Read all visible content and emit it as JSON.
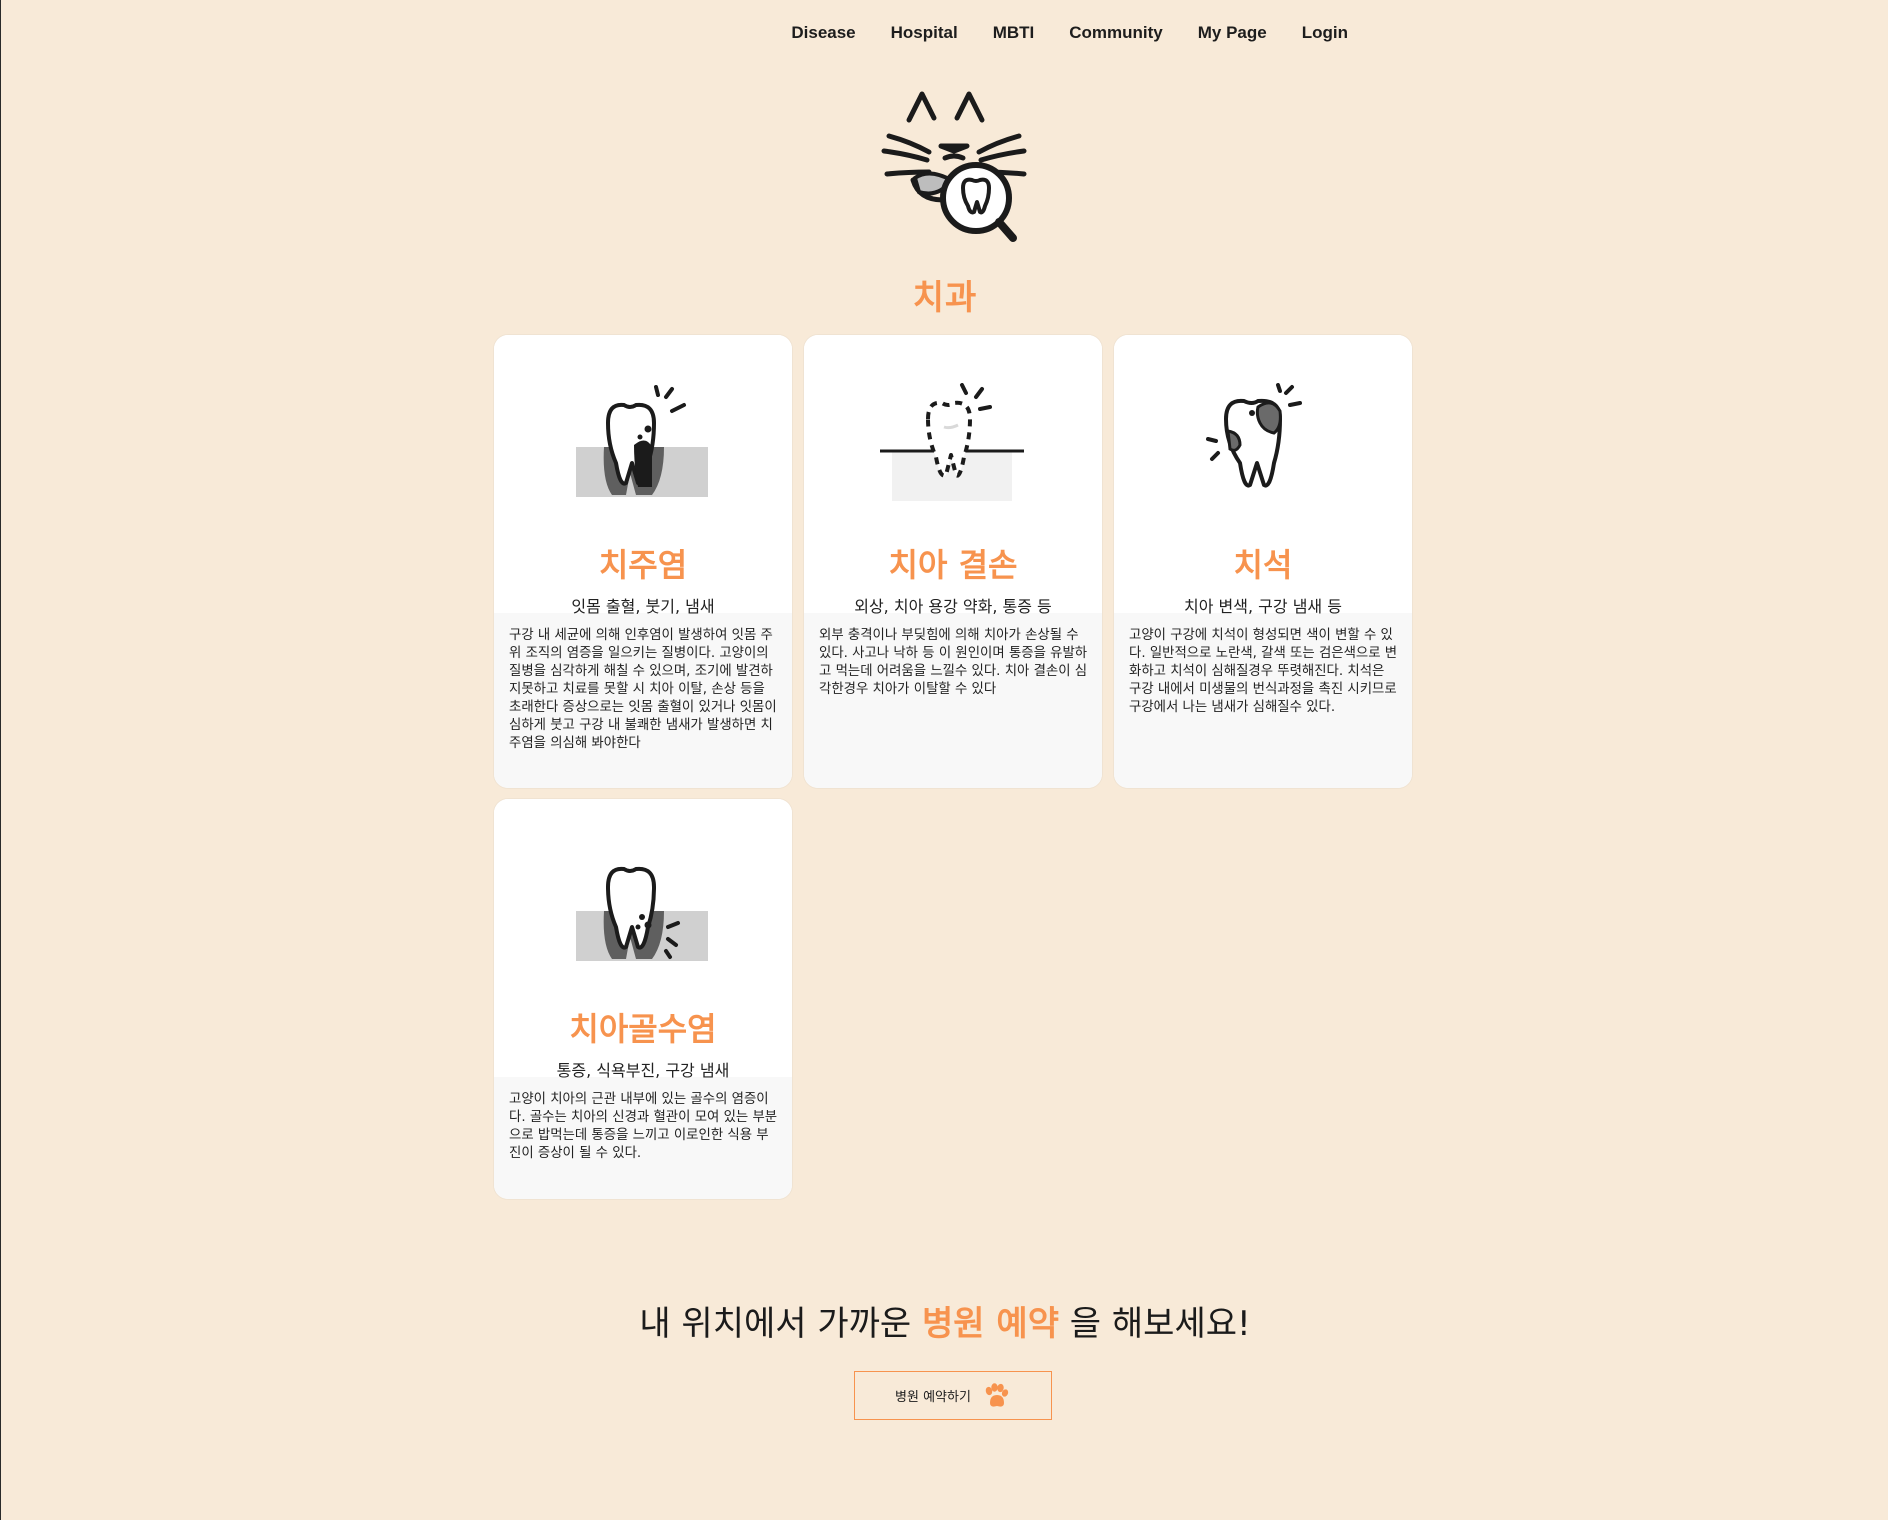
{
  "nav": {
    "items": [
      {
        "label": "Disease"
      },
      {
        "label": "Hospital"
      },
      {
        "label": "MBTI"
      },
      {
        "label": "Community"
      },
      {
        "label": "My Page"
      },
      {
        "label": "Login"
      }
    ]
  },
  "hero": {
    "logo_icon": "cat-tooth-magnifier-icon",
    "title": "치과"
  },
  "cards": [
    {
      "icon": "periodontitis-tooth-icon",
      "name": "치주염",
      "symptoms": "잇몸 출혈, 붓기, 냄새",
      "description": "구강 내 세균에 의해 인후염이 발생하여 잇몸 주위 조직의 염증을 일으키는 질병이다. 고양이의 질병을 심각하게 해칠 수 있으며, 조기에 발견하지못하고 치료를 못할 시 치아 이탈, 손상 등을 초래한다 증상으로는 잇몸 출혈이 있거나 잇몸이 심하게 붓고 구강 내 불쾌한 냄새가 발생하면 치주염을 의심해 봐야한다"
    },
    {
      "icon": "missing-tooth-icon",
      "name": "치아 결손",
      "symptoms": "외상, 치아 용강 약화, 통증 등",
      "description": "외부 충격이나 부딪힘에 의해 치아가 손상될 수 있다. 사고나 낙하 등 이 원인이며 통증을 유발하고 먹는데 어려움을 느낄수 있다. 치아 결손이 심각한경우 치아가 이탈할 수 있다"
    },
    {
      "icon": "tartar-tooth-icon",
      "name": "치석",
      "symptoms": "치아 변색, 구강 냄새 등",
      "description": "고양이 구강에 치석이 형성되면 색이 변할 수 있다. 일반적으로 노란색, 갈색 또는 검은색으로 변화하고 치석이 심해질경우 뚜렷해진다. 치석은 구강 내에서 미생물의 번식과정을 촉진 시키므로 구강에서 나는 냄새가 심해질수 있다."
    },
    {
      "icon": "pulpitis-tooth-icon",
      "name": "치아골수염",
      "symptoms": "통증, 식욕부진, 구강 냄새",
      "description": "고양이 치아의 근관 내부에 있는 골수의 염증이다. 골수는 치아의 신경과 혈관이 모여 있는 부분으로 밥먹는데 통증을 느끼고 이로인한 식용 부진이 증상이 될 수 있다."
    }
  ],
  "cta": {
    "text_before": "내 위치에서 가까운 ",
    "highlight": "병원 예약",
    "text_after": " 을 해보세요!",
    "button_label": "병원 예약하기",
    "button_icon": "paw-icon",
    "accent_color": "#f7934e"
  }
}
